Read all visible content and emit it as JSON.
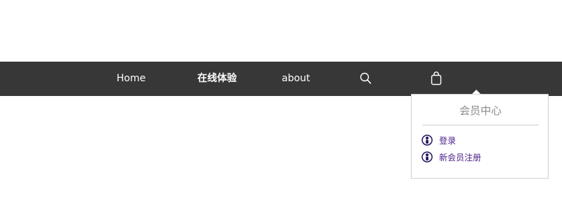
{
  "nav": {
    "home": "Home",
    "online_experience": "在线体验",
    "about": "about",
    "search_icon": "search-icon",
    "bag_icon": "shopping-bag-icon"
  },
  "member_center": {
    "title": "会员中心",
    "links": [
      {
        "label": "登录",
        "icon": "user-circle-icon"
      },
      {
        "label": "新会员注册",
        "icon": "user-circle-icon"
      }
    ]
  },
  "colors": {
    "navbar_bg": "#373737",
    "nav_text": "#ffffff",
    "panel_title": "#8a8a8a",
    "link_text": "#4b1f8a"
  }
}
